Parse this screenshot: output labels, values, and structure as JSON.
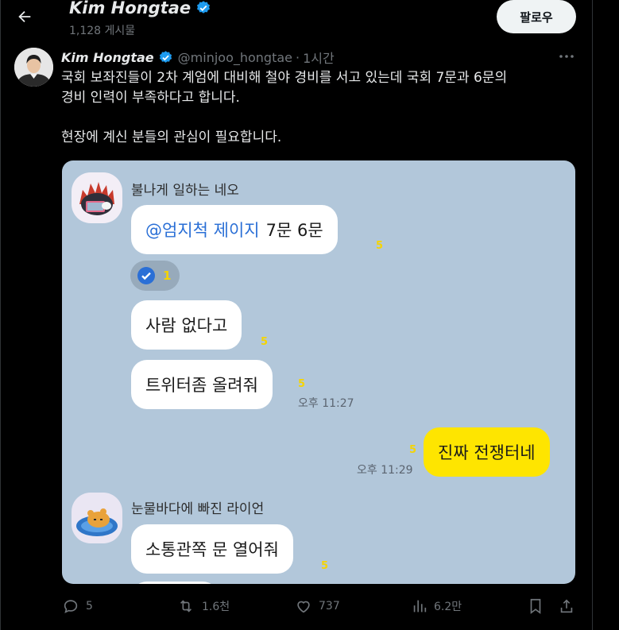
{
  "header": {
    "name": "Kim Hongtae",
    "post_count": "1,128 게시물",
    "follow_label": "팔로우"
  },
  "tweet": {
    "author_name": "Kim Hongtae",
    "handle": "@minjoo_hongtae",
    "separator": "·",
    "time": "1시간",
    "text_line1": "국회 보좌진들이 2차 계엄에 대비해 철야 경비를 서고 있는데 국회 7문과 6문의",
    "text_line2": "경비 인력이 부족하다고 합니다.",
    "text_line3": "현장에 계신 분들의 관심이 필요합니다."
  },
  "chat": {
    "sender1": "불나게 일하는 네오",
    "msg1_mention": "@엄지척 제이지",
    "msg1_text": "7문 6문",
    "msg1_unread": "5",
    "reaction_count": "1",
    "msg2_text": "사람 없다고",
    "msg2_unread": "5",
    "msg3_text": "트위터좀 올려줘",
    "msg3_unread": "5",
    "msg3_time": "오후 11:27",
    "msg4_text": "진짜 전쟁터네",
    "msg4_unread": "5",
    "msg4_time": "오후 11:29",
    "sender2": "눈물바다에 빠진 라이언",
    "msg5_text": "소통관쪽 문 열어줘",
    "msg5_unread": "5"
  },
  "actions": {
    "replies": "5",
    "reposts": "1.6천",
    "likes": "737",
    "views": "6.2만"
  },
  "colors": {
    "verified": "#1d9bf0",
    "chat_bg": "#b2c7da",
    "my_bubble": "#fee500",
    "unread": "#f5d400"
  },
  "icons": [
    "back-arrow-icon",
    "verified-icon",
    "more-icon",
    "reply-icon",
    "repost-icon",
    "like-icon",
    "views-icon",
    "bookmark-icon",
    "share-icon",
    "check-icon"
  ]
}
